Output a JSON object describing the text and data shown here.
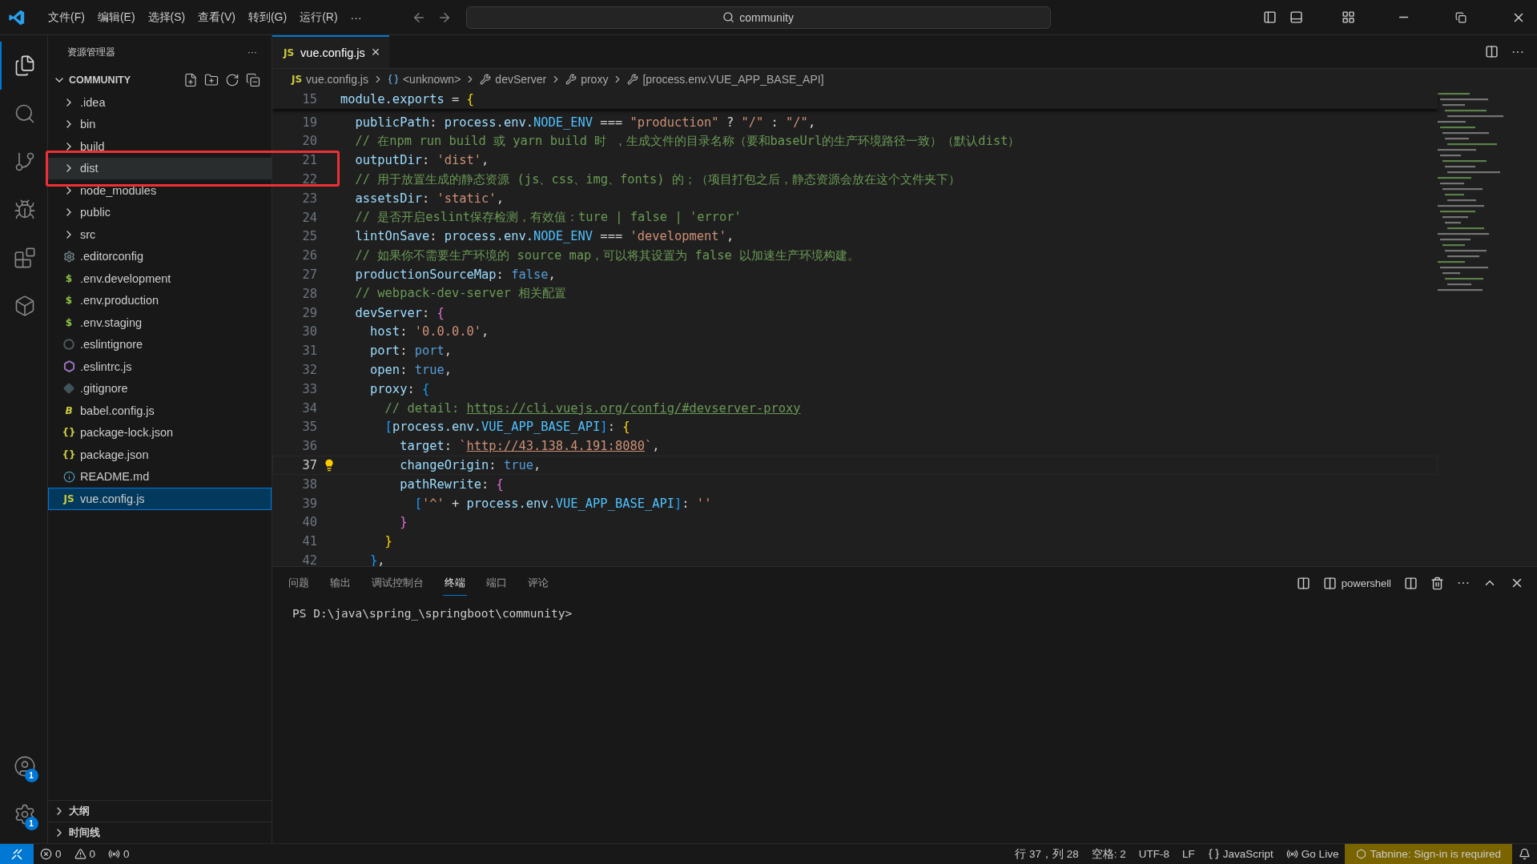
{
  "title_bar": {
    "menus": [
      "文件(F)",
      "编辑(E)",
      "选择(S)",
      "查看(V)",
      "转到(G)",
      "运行(R)",
      "···"
    ],
    "search": {
      "value": "community"
    }
  },
  "activity_bar": {
    "items": [
      {
        "kind": "explorer",
        "selected": true
      },
      {
        "kind": "search",
        "selected": false
      },
      {
        "kind": "scm",
        "selected": false
      },
      {
        "kind": "debug",
        "selected": false
      },
      {
        "kind": "extensions",
        "selected": false
      },
      {
        "kind": "remote",
        "selected": false
      }
    ],
    "bottom": [
      {
        "kind": "account",
        "badge": "1"
      },
      {
        "kind": "settings",
        "badge": "1"
      }
    ]
  },
  "sidebar": {
    "title": "资源管理器",
    "more": "···",
    "root": {
      "label": "COMMUNITY",
      "expanded": true
    },
    "items": [
      {
        "kind": "folder",
        "label": ".idea",
        "selected": false,
        "hovered": false
      },
      {
        "kind": "folder",
        "label": "bin",
        "selected": false,
        "hovered": false
      },
      {
        "kind": "folder",
        "label": "build",
        "selected": false,
        "hovered": false
      },
      {
        "kind": "folder",
        "label": "dist",
        "selected": false,
        "hovered": true
      },
      {
        "kind": "folder",
        "label": "node_modules",
        "selected": false,
        "hovered": false
      },
      {
        "kind": "folder",
        "label": "public",
        "selected": false,
        "hovered": false
      },
      {
        "kind": "folder",
        "label": "src",
        "selected": false,
        "hovered": false
      },
      {
        "kind": "settings",
        "label": ".editorconfig",
        "selected": false,
        "hovered": false
      },
      {
        "kind": "env",
        "glyph": "$",
        "label": ".env.development",
        "selected": false,
        "hovered": false
      },
      {
        "kind": "env",
        "glyph": "$",
        "label": ".env.production",
        "selected": false,
        "hovered": false
      },
      {
        "kind": "env",
        "glyph": "$",
        "label": ".env.staging",
        "selected": false,
        "hovered": false
      },
      {
        "kind": "ignore",
        "label": ".eslintignore",
        "selected": false,
        "hovered": false
      },
      {
        "kind": "eslint",
        "label": ".eslintrc.js",
        "selected": false,
        "hovered": false
      },
      {
        "kind": "git",
        "label": ".gitignore",
        "selected": false,
        "hovered": false
      },
      {
        "kind": "babel",
        "glyph": "B",
        "label": "babel.config.js",
        "selected": false,
        "hovered": false
      },
      {
        "kind": "json",
        "glyph": "{}",
        "label": "package-lock.json",
        "selected": false,
        "hovered": false
      },
      {
        "kind": "json",
        "glyph": "{}",
        "label": "package.json",
        "selected": false,
        "hovered": false
      },
      {
        "kind": "readme",
        "label": "README.md",
        "selected": false,
        "hovered": false
      },
      {
        "kind": "js",
        "glyph": "JS",
        "label": "vue.config.js",
        "selected": true,
        "hovered": false
      }
    ],
    "sections": [
      {
        "label": "大纲",
        "expanded": false
      },
      {
        "label": "时间线",
        "expanded": false
      }
    ]
  },
  "editor": {
    "tabs": [
      {
        "glyph": "JS",
        "label": "vue.config.js",
        "selected": true,
        "close": "×"
      }
    ],
    "breadcrumb": [
      {
        "kind": "file",
        "glyph": "JS",
        "label": "vue.config.js"
      },
      {
        "kind": "object",
        "label": "<unknown>"
      },
      {
        "kind": "wrench",
        "label": "devServer"
      },
      {
        "kind": "wrench",
        "label": "proxy"
      },
      {
        "kind": "wrench",
        "label": "[process.env.VUE_APP_BASE_API]"
      }
    ],
    "sticky": {
      "number": "15",
      "tokens": [
        {
          "text": "module.exports",
          "kind": "prop"
        },
        {
          "text": " = ",
          "kind": "plain"
        },
        {
          "text": "{",
          "kind": "brace1"
        }
      ]
    },
    "lines": [
      {
        "number": "19",
        "current": false,
        "tokens": [
          {
            "text": "  publicPath",
            "kind": "prop"
          },
          {
            "text": ": ",
            "kind": "plain"
          },
          {
            "text": "process.env.",
            "kind": "prop"
          },
          {
            "text": "NODE_ENV",
            "kind": "const"
          },
          {
            "text": " === ",
            "kind": "plain"
          },
          {
            "text": "\"production\"",
            "kind": "str"
          },
          {
            "text": " ? ",
            "kind": "plain"
          },
          {
            "text": "\"/\"",
            "kind": "str"
          },
          {
            "text": " : ",
            "kind": "plain"
          },
          {
            "text": "\"/\"",
            "kind": "str"
          },
          {
            "text": ",",
            "kind": "plain"
          }
        ]
      },
      {
        "number": "20",
        "current": false,
        "tokens": [
          {
            "text": "  // 在npm run build 或 yarn build 时 ，生成文件的目录名称（要和baseUrl的生产环境路径一致）（默认dist）",
            "kind": "comment"
          }
        ]
      },
      {
        "number": "21",
        "current": false,
        "tokens": [
          {
            "text": "  outputDir",
            "kind": "prop"
          },
          {
            "text": ": ",
            "kind": "plain"
          },
          {
            "text": "'dist'",
            "kind": "str"
          },
          {
            "text": ",",
            "kind": "plain"
          }
        ]
      },
      {
        "number": "22",
        "current": false,
        "tokens": [
          {
            "text": "  // 用于放置生成的静态资源 (js、css、img、fonts) 的；（项目打包之后，静态资源会放在这个文件夹下）",
            "kind": "comment"
          }
        ]
      },
      {
        "number": "23",
        "current": false,
        "tokens": [
          {
            "text": "  assetsDir",
            "kind": "prop"
          },
          {
            "text": ": ",
            "kind": "plain"
          },
          {
            "text": "'static'",
            "kind": "str"
          },
          {
            "text": ",",
            "kind": "plain"
          }
        ]
      },
      {
        "number": "24",
        "current": false,
        "tokens": [
          {
            "text": "  // 是否开启eslint保存检测，有效值：ture | false | 'error'",
            "kind": "comment"
          }
        ]
      },
      {
        "number": "25",
        "current": false,
        "tokens": [
          {
            "text": "  lintOnSave",
            "kind": "prop"
          },
          {
            "text": ": ",
            "kind": "plain"
          },
          {
            "text": "process.env.",
            "kind": "prop"
          },
          {
            "text": "NODE_ENV",
            "kind": "const"
          },
          {
            "text": " === ",
            "kind": "plain"
          },
          {
            "text": "'development'",
            "kind": "str"
          },
          {
            "text": ",",
            "kind": "plain"
          }
        ]
      },
      {
        "number": "26",
        "current": false,
        "tokens": [
          {
            "text": "  // 如果你不需要生产环境的 source map，可以将其设置为 false 以加速生产环境构建。",
            "kind": "comment"
          }
        ]
      },
      {
        "number": "27",
        "current": false,
        "tokens": [
          {
            "text": "  productionSourceMap",
            "kind": "prop"
          },
          {
            "text": ": ",
            "kind": "plain"
          },
          {
            "text": "false",
            "kind": "keyword"
          },
          {
            "text": ",",
            "kind": "plain"
          }
        ]
      },
      {
        "number": "28",
        "current": false,
        "tokens": [
          {
            "text": "  // webpack-dev-server 相关配置",
            "kind": "comment"
          }
        ]
      },
      {
        "number": "29",
        "current": false,
        "tokens": [
          {
            "text": "  devServer",
            "kind": "prop"
          },
          {
            "text": ": ",
            "kind": "plain"
          },
          {
            "text": "{",
            "kind": "brace2"
          }
        ]
      },
      {
        "number": "30",
        "current": false,
        "tokens": [
          {
            "text": "    host",
            "kind": "prop"
          },
          {
            "text": ": ",
            "kind": "plain"
          },
          {
            "text": "'0.0.0.0'",
            "kind": "str"
          },
          {
            "text": ",",
            "kind": "plain"
          }
        ]
      },
      {
        "number": "31",
        "current": false,
        "tokens": [
          {
            "text": "    port",
            "kind": "prop"
          },
          {
            "text": ": ",
            "kind": "plain"
          },
          {
            "text": "port",
            "kind": "keyword"
          },
          {
            "text": ",",
            "kind": "plain"
          }
        ]
      },
      {
        "number": "32",
        "current": false,
        "tokens": [
          {
            "text": "    open",
            "kind": "prop"
          },
          {
            "text": ": ",
            "kind": "plain"
          },
          {
            "text": "true",
            "kind": "keyword"
          },
          {
            "text": ",",
            "kind": "plain"
          }
        ]
      },
      {
        "number": "33",
        "current": false,
        "tokens": [
          {
            "text": "    proxy",
            "kind": "prop"
          },
          {
            "text": ": ",
            "kind": "plain"
          },
          {
            "text": "{",
            "kind": "brace3"
          }
        ]
      },
      {
        "number": "34",
        "current": false,
        "tokens": [
          {
            "text": "      // detail: ",
            "kind": "comment"
          },
          {
            "text": "https://cli.vuejs.org/config/#devserver-proxy",
            "kind": "link"
          }
        ]
      },
      {
        "number": "35",
        "current": false,
        "tokens": [
          {
            "text": "      [",
            "kind": "brace3"
          },
          {
            "text": "process.env.",
            "kind": "prop"
          },
          {
            "text": "VUE_APP_BASE_API",
            "kind": "const"
          },
          {
            "text": "]",
            "kind": "brace3"
          },
          {
            "text": ": ",
            "kind": "plain"
          },
          {
            "text": "{",
            "kind": "brace1"
          }
        ]
      },
      {
        "number": "36",
        "current": false,
        "tokens": [
          {
            "text": "        target",
            "kind": "prop"
          },
          {
            "text": ": ",
            "kind": "plain"
          },
          {
            "text": "`",
            "kind": "str"
          },
          {
            "text": "http://43.138.4.191:8080",
            "kind": "strlink"
          },
          {
            "text": "`",
            "kind": "str"
          },
          {
            "text": ",",
            "kind": "plain"
          }
        ]
      },
      {
        "number": "37",
        "current": true,
        "tokens": [
          {
            "text": "        changeOrigin",
            "kind": "prop"
          },
          {
            "text": ": ",
            "kind": "plain"
          },
          {
            "text": "true",
            "kind": "keyword"
          },
          {
            "text": ",",
            "kind": "plain"
          }
        ]
      },
      {
        "number": "38",
        "current": false,
        "tokens": [
          {
            "text": "        pathRewrite",
            "kind": "prop"
          },
          {
            "text": ": ",
            "kind": "plain"
          },
          {
            "text": "{",
            "kind": "brace2"
          }
        ]
      },
      {
        "number": "39",
        "current": false,
        "tokens": [
          {
            "text": "          [",
            "kind": "brace3"
          },
          {
            "text": "'^'",
            "kind": "str"
          },
          {
            "text": " + ",
            "kind": "plain"
          },
          {
            "text": "process.env.",
            "kind": "prop"
          },
          {
            "text": "VUE_APP_BASE_API",
            "kind": "const"
          },
          {
            "text": "]",
            "kind": "brace3"
          },
          {
            "text": ": ",
            "kind": "plain"
          },
          {
            "text": "''",
            "kind": "str"
          }
        ]
      },
      {
        "number": "40",
        "current": false,
        "tokens": [
          {
            "text": "        }",
            "kind": "brace2"
          }
        ]
      },
      {
        "number": "41",
        "current": false,
        "tokens": [
          {
            "text": "      }",
            "kind": "brace1"
          }
        ]
      },
      {
        "number": "42",
        "current": false,
        "tokens": [
          {
            "text": "    }",
            "kind": "brace3"
          },
          {
            "text": ",",
            "kind": "plain"
          }
        ]
      }
    ]
  },
  "panel": {
    "tabs": [
      {
        "label": "问题",
        "selected": false
      },
      {
        "label": "输出",
        "selected": false
      },
      {
        "label": "调试控制台",
        "selected": false
      },
      {
        "label": "终端",
        "selected": true
      },
      {
        "label": "端口",
        "selected": false
      },
      {
        "label": "评论",
        "selected": false
      }
    ],
    "terminal_name": "powershell",
    "more": "···",
    "terminal_lines": [
      "PS D:\\java\\spring_\\springboot\\community>"
    ]
  },
  "status_bar": {
    "left": [
      {
        "kind": "errors",
        "text": "0"
      },
      {
        "kind": "warnings",
        "text": "0"
      },
      {
        "kind": "ports",
        "text": "0"
      }
    ],
    "right": [
      {
        "kind": "text",
        "text": "行 37，列 28"
      },
      {
        "kind": "text",
        "text": "空格: 2"
      },
      {
        "kind": "text",
        "text": "UTF-8"
      },
      {
        "kind": "text",
        "text": "LF"
      },
      {
        "kind": "language",
        "text": "JavaScript"
      },
      {
        "kind": "golive",
        "text": "Go Live"
      },
      {
        "kind": "tabnine",
        "text": "Tabnine: Sign-in is required"
      },
      {
        "kind": "bell"
      }
    ]
  }
}
